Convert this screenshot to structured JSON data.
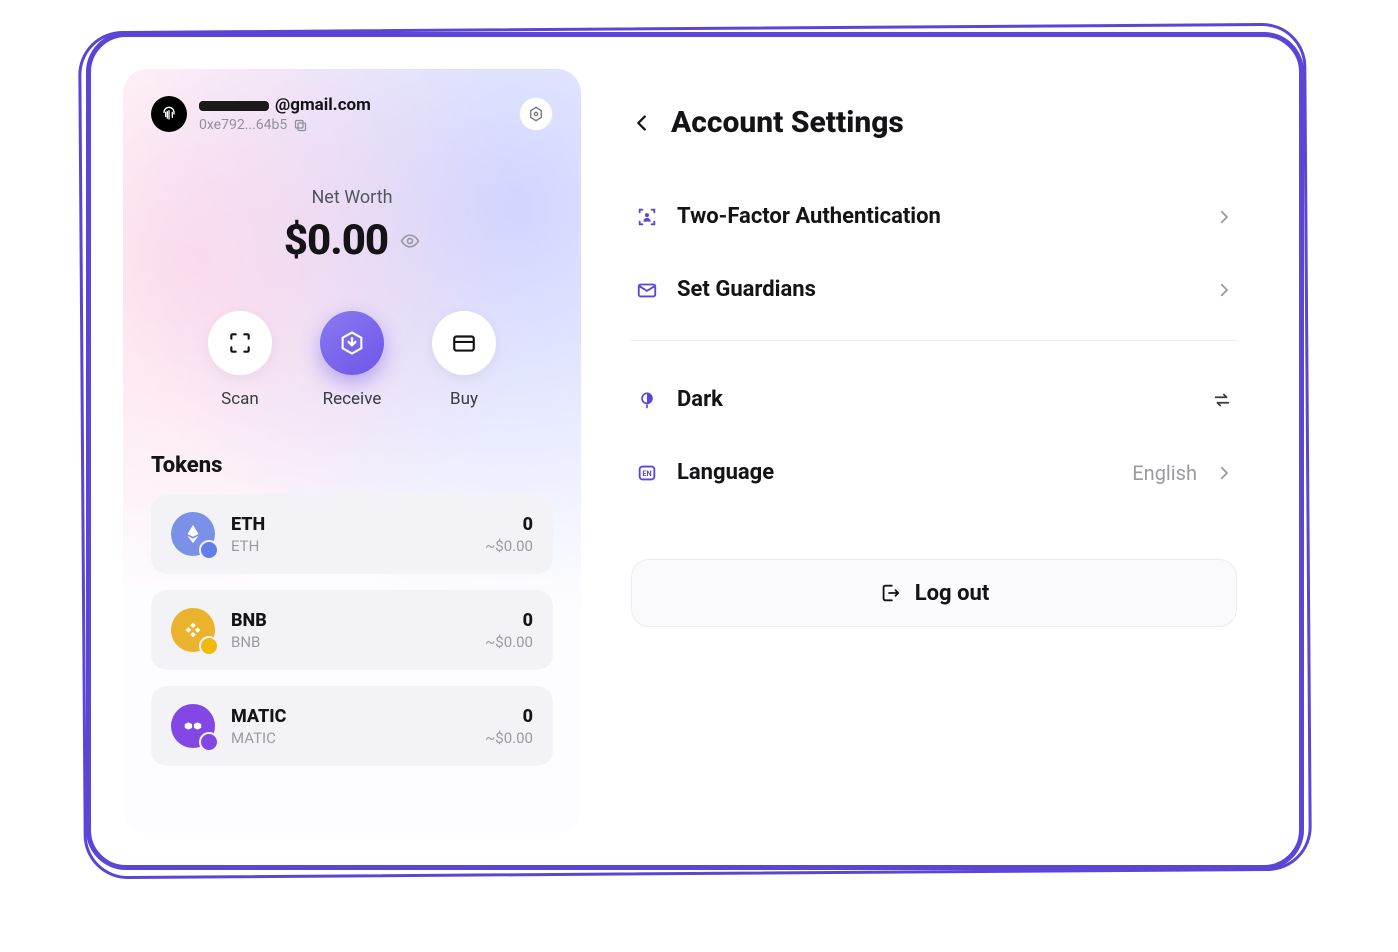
{
  "wallet": {
    "email_suffix": "@gmail.com",
    "address_short": "0xe792...64b5",
    "networth_label": "Net Worth",
    "networth_value": "$0.00",
    "actions": {
      "scan": "Scan",
      "receive": "Receive",
      "buy": "Buy"
    },
    "tokens_title": "Tokens",
    "tokens": [
      {
        "symbol": "ETH",
        "name": "ETH",
        "balance": "0",
        "usd": "~$0.00"
      },
      {
        "symbol": "BNB",
        "name": "BNB",
        "balance": "0",
        "usd": "~$0.00"
      },
      {
        "symbol": "MATIC",
        "name": "MATIC",
        "balance": "0",
        "usd": "~$0.00"
      }
    ]
  },
  "settings": {
    "title": "Account Settings",
    "twofa": "Two-Factor Authentication",
    "guardians": "Set Guardians",
    "theme_label": "Dark",
    "language_label": "Language",
    "language_value": "English",
    "logout": "Log out"
  }
}
